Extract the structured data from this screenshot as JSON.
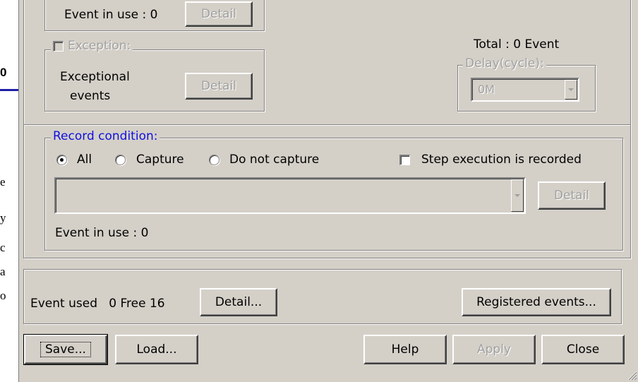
{
  "background_fragments": {
    "line1": "0",
    "line2": "e",
    "line3": "y",
    "line4": "c",
    "line5": "a",
    "line6": "o"
  },
  "top_group": {
    "event_in_use_label": "Event in use : 0",
    "detail_label": "Detail"
  },
  "exception_group": {
    "legend": "Exception:",
    "exceptional_events_label": "Exceptional\nevents",
    "line1": "Exceptional",
    "line2": "events",
    "detail_label": "Detail",
    "checked": false
  },
  "total": {
    "label": "Total : 0  Event"
  },
  "delay_group": {
    "legend": "Delay(cycle):",
    "selected_value": "0M"
  },
  "record_condition": {
    "legend": "Record condition:",
    "options": [
      "All",
      "Capture",
      "Do not capture"
    ],
    "selected": "All",
    "step_execution_label": "Step execution is recorded",
    "step_execution_checked": false,
    "combo_value": "",
    "detail_label": "Detail",
    "event_in_use_label": "Event in use : 0"
  },
  "footer": {
    "event_used_label": "Event used",
    "event_used_value": "0",
    "free_label": "Free",
    "free_value": "16",
    "detail_button": "Detail...",
    "registered_events_button": "Registered events..."
  },
  "buttons": {
    "save": "Save...",
    "load": "Load...",
    "help": "Help",
    "apply": "Apply",
    "close": "Close"
  },
  "colors": {
    "dialog_bg": "#d4d0c8",
    "legend_blue": "#1010e0",
    "disabled_text": "#a0a0a0"
  }
}
